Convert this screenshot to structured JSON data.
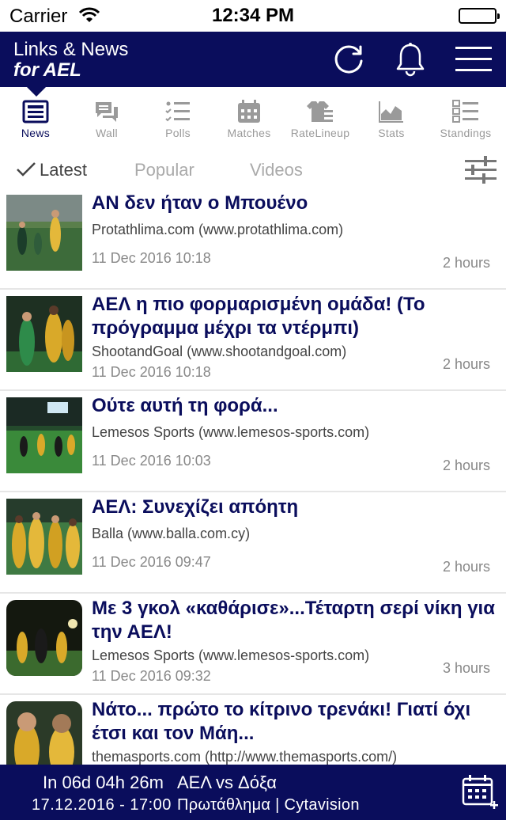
{
  "status_bar": {
    "carrier": "Carrier",
    "time": "12:34 PM"
  },
  "header": {
    "title_line1": "Links & News",
    "title_line2": "for AEL",
    "icons": [
      "refresh-icon",
      "bell-icon",
      "hamburger-menu-icon"
    ],
    "color": "#0a0d5c"
  },
  "tabs": [
    {
      "label": "News",
      "icon": "newspaper-icon",
      "active": true
    },
    {
      "label": "Wall",
      "icon": "chat-bubbles-icon",
      "active": false
    },
    {
      "label": "Polls",
      "icon": "checklist-icon",
      "active": false
    },
    {
      "label": "Matches",
      "icon": "calendar-icon",
      "active": false
    },
    {
      "label": "RateLineup",
      "icon": "jersey-icon",
      "active": false
    },
    {
      "label": "Stats",
      "icon": "area-chart-icon",
      "active": false
    },
    {
      "label": "Standings",
      "icon": "numbered-list-icon",
      "active": false
    }
  ],
  "filters": {
    "latest": "Latest",
    "popular": "Popular",
    "videos": "Videos",
    "active": "latest",
    "settings_icon": "sliders-icon"
  },
  "news": [
    {
      "title": "ΑΝ δεν ήταν ο Μπουένο",
      "source": "Protathlima.com (www.protathlima.com)",
      "date": "11 Dec 2016 10:18",
      "ago": "2 hours"
    },
    {
      "title": "ΑΕΛ η πιο φορμαρισμένη ομάδα! (Το πρόγραμμα μέχρι τα ντέρμπι)",
      "source": "ShootandGoal (www.shootandgoal.com)",
      "date": "11 Dec 2016 10:18",
      "ago": "2 hours"
    },
    {
      "title": "Ούτε αυτή τη φορά...",
      "source": "Lemesos Sports (www.lemesos-sports.com)",
      "date": "11 Dec 2016 10:03",
      "ago": "2 hours"
    },
    {
      "title": "ΑΕΛ: Συνεχίζει απόητη",
      "source": "Balla (www.balla.com.cy)",
      "date": "11 Dec 2016 09:47",
      "ago": "2 hours"
    },
    {
      "title": "Με 3 γκολ «καθάρισε»...Τέταρτη σερί νίκη για την ΑΕΛ!",
      "source": "Lemesos Sports (www.lemesos-sports.com)",
      "date": "11 Dec 2016 09:32",
      "ago": "3 hours"
    },
    {
      "title": "Νάτο... πρώτο το κίτρινο τρενάκι! Γιατί όχι έτσι και τον Μάη...",
      "source": "themasports.com (http://www.themasports.com/)",
      "date": "",
      "ago": ""
    }
  ],
  "next_match": {
    "countdown": "In 06d 04h 26m",
    "teams": "ΑΕΛ vs Δόξα",
    "datetime": "17.12.2016 - 17:00",
    "competition": "Πρωτάθλημα | Cytavision",
    "icon": "calendar-add-icon"
  }
}
